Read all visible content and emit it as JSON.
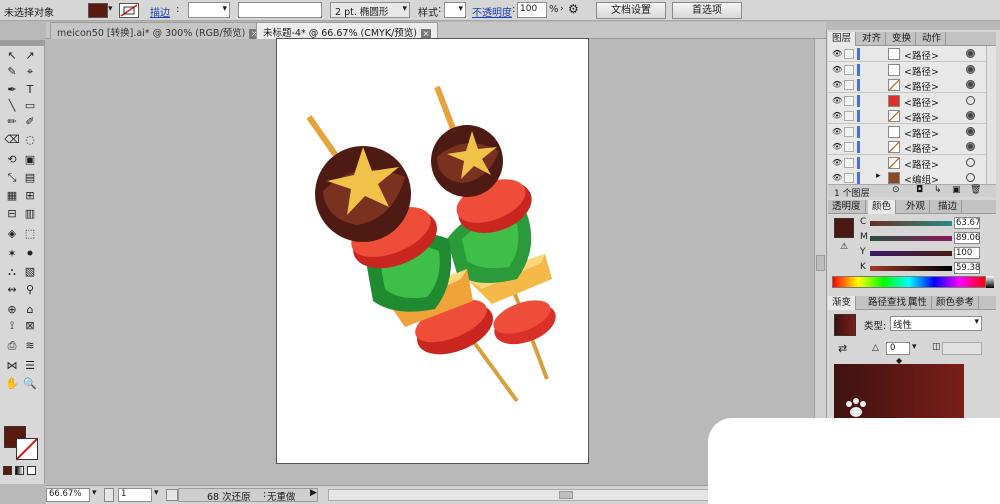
{
  "control_bar": {
    "selection_label": "未选择对象",
    "fill_color": "#5a1a12",
    "stroke_label": "描边",
    "brush_label": "2 pt. 椭圆形",
    "style_label": "样式",
    "opacity_label": "不透明度",
    "opacity_value": "100",
    "opacity_unit": "%",
    "doc_settings_button": "文档设置",
    "preferences_button": "首选项"
  },
  "tabs": [
    {
      "label": "meicon50 [转换].ai* @ 300% (RGB/预览)",
      "active": false
    },
    {
      "label": "未标题-4* @ 66.67% (CMYK/预览)",
      "active": true
    }
  ],
  "status_bar": {
    "zoom": "66.67%",
    "artboard": "1",
    "history": "68 次还原",
    "redo": "无重做"
  },
  "layers_panel": {
    "tabs": [
      "图层",
      "对齐",
      "变换",
      "动作"
    ],
    "rows": [
      {
        "name": "<路径>",
        "thumb": "white",
        "target": "filled"
      },
      {
        "name": "<路径>",
        "thumb": "white",
        "target": "filled"
      },
      {
        "name": "<路径>",
        "thumb": "line",
        "target": "filled"
      },
      {
        "name": "<路径>",
        "thumb": "red",
        "target": "empty"
      },
      {
        "name": "<路径>",
        "thumb": "line",
        "target": "filled"
      },
      {
        "name": "<路径>",
        "thumb": "white",
        "target": "filled"
      },
      {
        "name": "<路径>",
        "thumb": "line",
        "target": "filled"
      },
      {
        "name": "<路径>",
        "thumb": "line",
        "target": "empty"
      },
      {
        "name": "<编组>",
        "thumb": "group",
        "target": "empty"
      }
    ],
    "footer": "1 个图层"
  },
  "color_panel": {
    "tabs": [
      "透明度",
      "颜色",
      "外观",
      "描边"
    ],
    "c": "63.67",
    "m": "89.06",
    "y": "100",
    "k": "59.38",
    "swatch": "#4a1a12"
  },
  "gradient_panel": {
    "tabs": [
      "渐变",
      "路径查找",
      "属性",
      "颜色参考"
    ],
    "type_label": "类型:",
    "type_value": "线性",
    "angle": "0",
    "start_color": "#3e1210",
    "end_color": "#7a1e1a"
  }
}
